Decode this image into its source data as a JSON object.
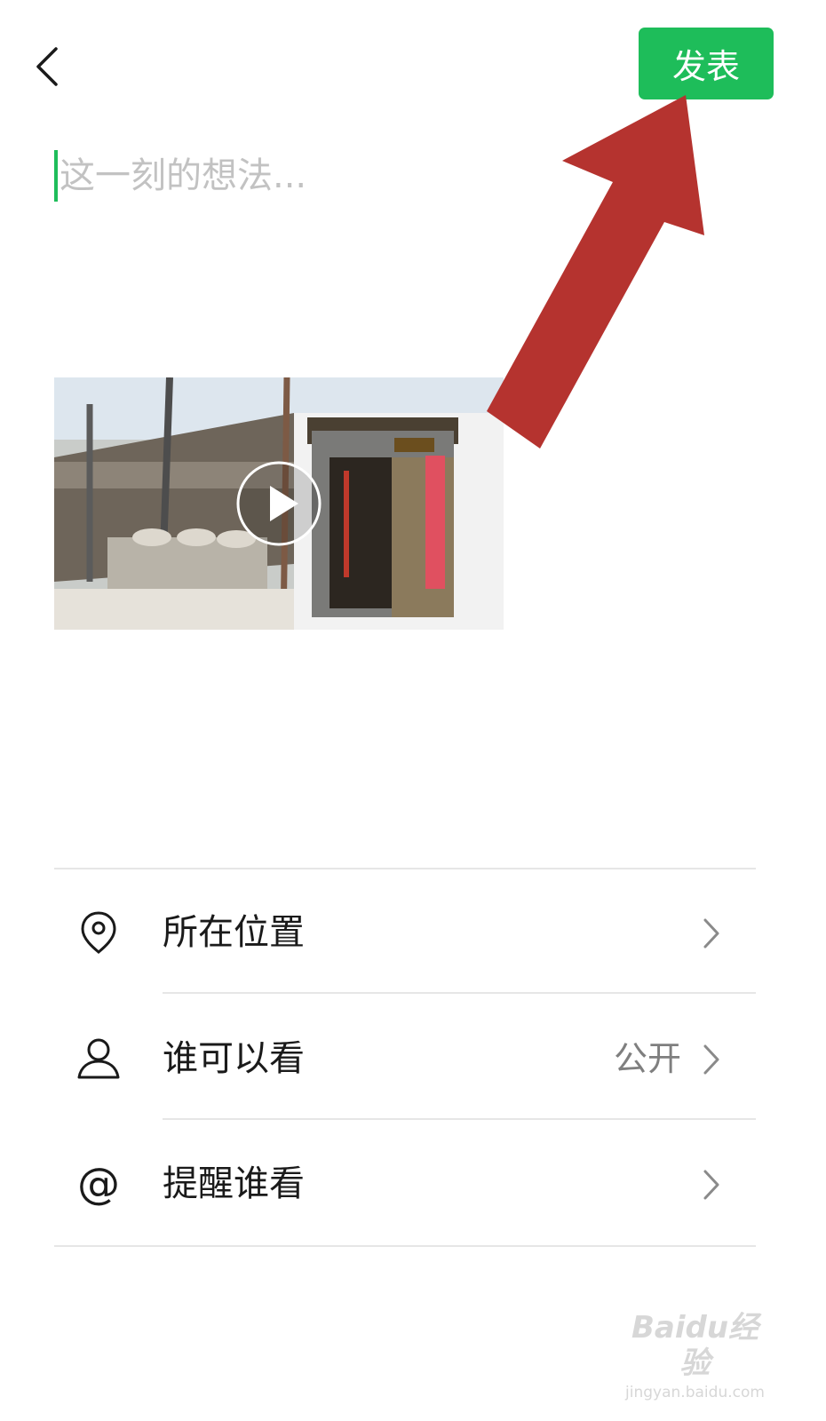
{
  "header": {
    "back_icon": "chevron-left-icon",
    "publish_label": "发表",
    "publish_color": "#1ebd5a"
  },
  "composer": {
    "placeholder": "这一刻的想法..."
  },
  "media": {
    "type": "video",
    "play_icon": "play-icon"
  },
  "options": [
    {
      "icon": "location-pin-icon",
      "label": "所在位置",
      "value": ""
    },
    {
      "icon": "person-icon",
      "label": "谁可以看",
      "value": "公开"
    },
    {
      "icon": "at-sign-icon",
      "label": "提醒谁看",
      "value": ""
    }
  ],
  "watermark": {
    "logo": "Baidu经验",
    "url": "jingyan.baidu.com"
  }
}
